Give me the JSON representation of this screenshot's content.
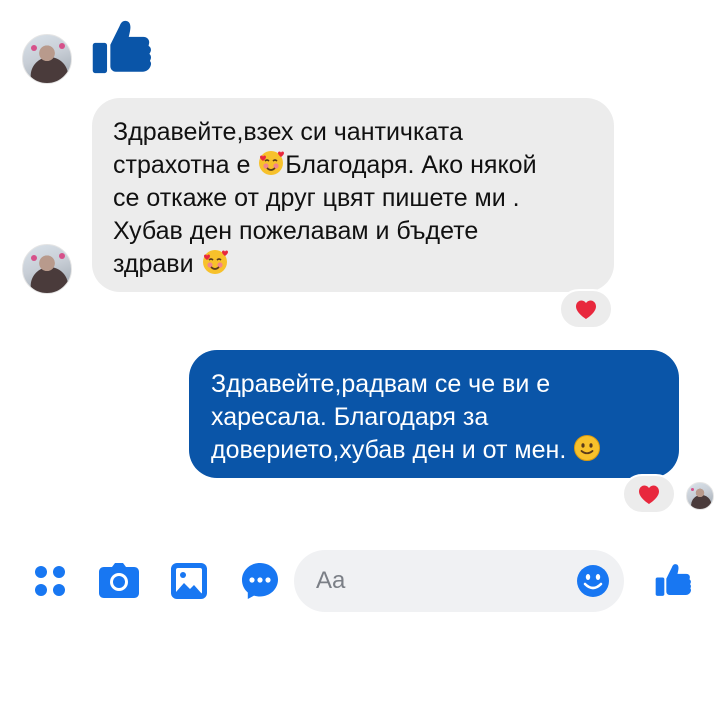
{
  "conversation": {
    "messages": [
      {
        "sender": "contact",
        "type": "like"
      },
      {
        "sender": "contact",
        "type": "text",
        "lines": [
          "Здравейте,взех си чантичката",
          "страхотна е ",
          "Благодаря. Ако някой",
          "се откаже от друг цвят пишете ми .",
          "Хубав ден пожелавам и бъдете",
          "здрави "
        ],
        "reaction": "heart"
      },
      {
        "sender": "me",
        "type": "text",
        "lines": [
          "Здравейте,радвам се че ви е",
          "харесала. Благодаря за",
          "доверието,хубав ден и от мен. "
        ],
        "reaction": "heart"
      }
    ]
  },
  "composer": {
    "placeholder": "Aa",
    "icons": [
      "apps-icon",
      "camera-icon",
      "gallery-icon",
      "chat-options-icon",
      "emoji-icon",
      "like-icon"
    ]
  },
  "colors": {
    "accent": "#0a55a8",
    "incoming_bubble": "#ececec",
    "heart": "#e8283d",
    "toolbar_icon": "#1877f2"
  }
}
